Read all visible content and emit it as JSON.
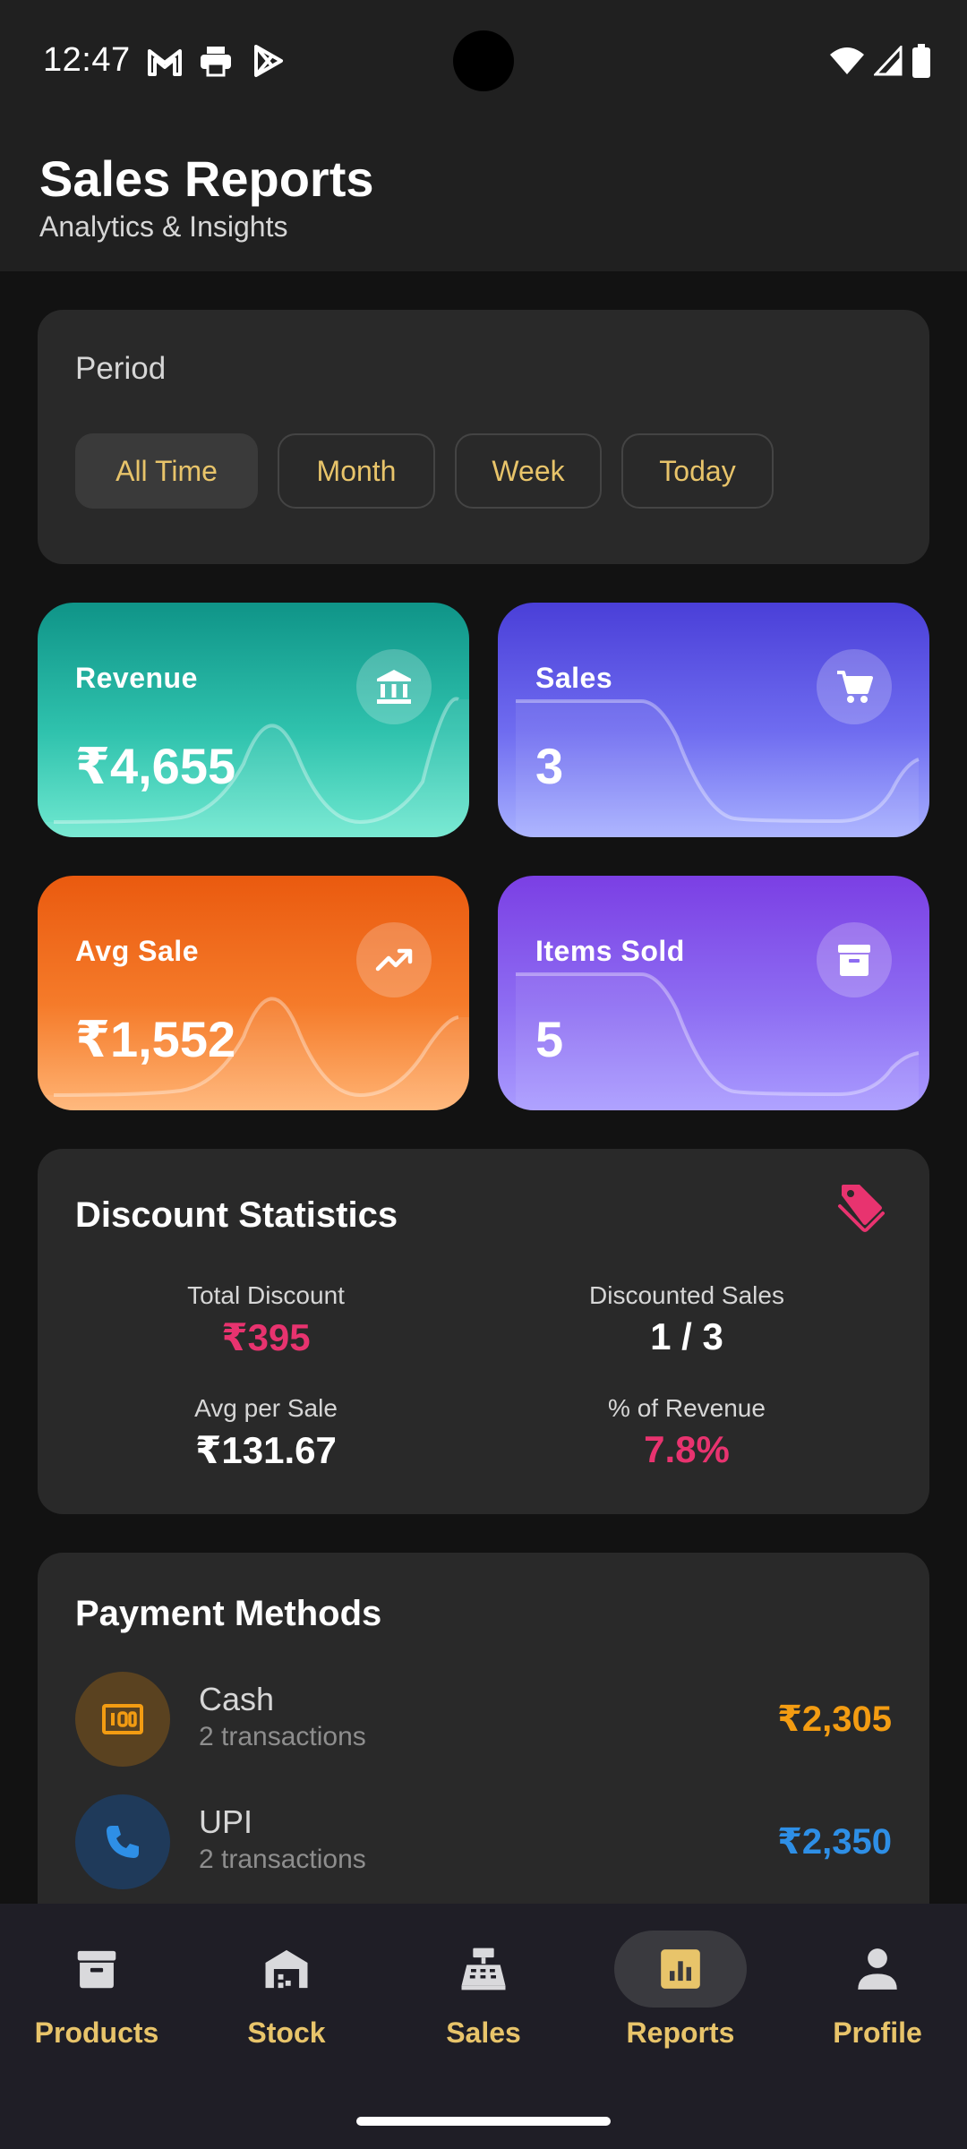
{
  "status": {
    "time": "12:47"
  },
  "header": {
    "title": "Sales Reports",
    "subtitle": "Analytics & Insights"
  },
  "period": {
    "title": "Period",
    "options": [
      "All Time",
      "Month",
      "Week",
      "Today"
    ],
    "selected": "All Time"
  },
  "stats": [
    {
      "label": "Revenue",
      "value": "₹4,655",
      "icon": "bank-icon"
    },
    {
      "label": "Sales",
      "value": "3",
      "icon": "cart-icon"
    },
    {
      "label": "Avg Sale",
      "value": "₹1,552",
      "icon": "trending-up-icon"
    },
    {
      "label": "Items Sold",
      "value": "5",
      "icon": "archive-box-icon"
    }
  ],
  "discount": {
    "title": "Discount Statistics",
    "total_discount_label": "Total Discount",
    "total_discount_value": "₹395",
    "discounted_sales_label": "Discounted Sales",
    "discounted_sales_value": "1 / 3",
    "avg_per_sale_label": "Avg per Sale",
    "avg_per_sale_value": "₹131.67",
    "pct_revenue_label": "% of Revenue",
    "pct_revenue_value": "7.8%"
  },
  "payments": {
    "title": "Payment Methods",
    "methods": [
      {
        "name": "Cash",
        "transactions": "2 transactions",
        "amount": "₹2,305",
        "color": "#f39c12"
      },
      {
        "name": "UPI",
        "transactions": "2 transactions",
        "amount": "₹2,350",
        "color": "#2e8fe6"
      }
    ]
  },
  "nav": {
    "items": [
      "Products",
      "Stock",
      "Sales",
      "Reports",
      "Profile"
    ],
    "active": "Reports"
  },
  "colors": {
    "accent": "#e8c46a",
    "discount_pink": "#e8336f",
    "revenue_gradient": [
      "#0f9488",
      "#6fe8d0"
    ],
    "sales_gradient": [
      "#4a3fd8",
      "#a7b0ff"
    ],
    "avg_gradient": [
      "#ea5a0f",
      "#ffb373"
    ],
    "items_gradient": [
      "#7b3fe4",
      "#a99bff"
    ]
  }
}
